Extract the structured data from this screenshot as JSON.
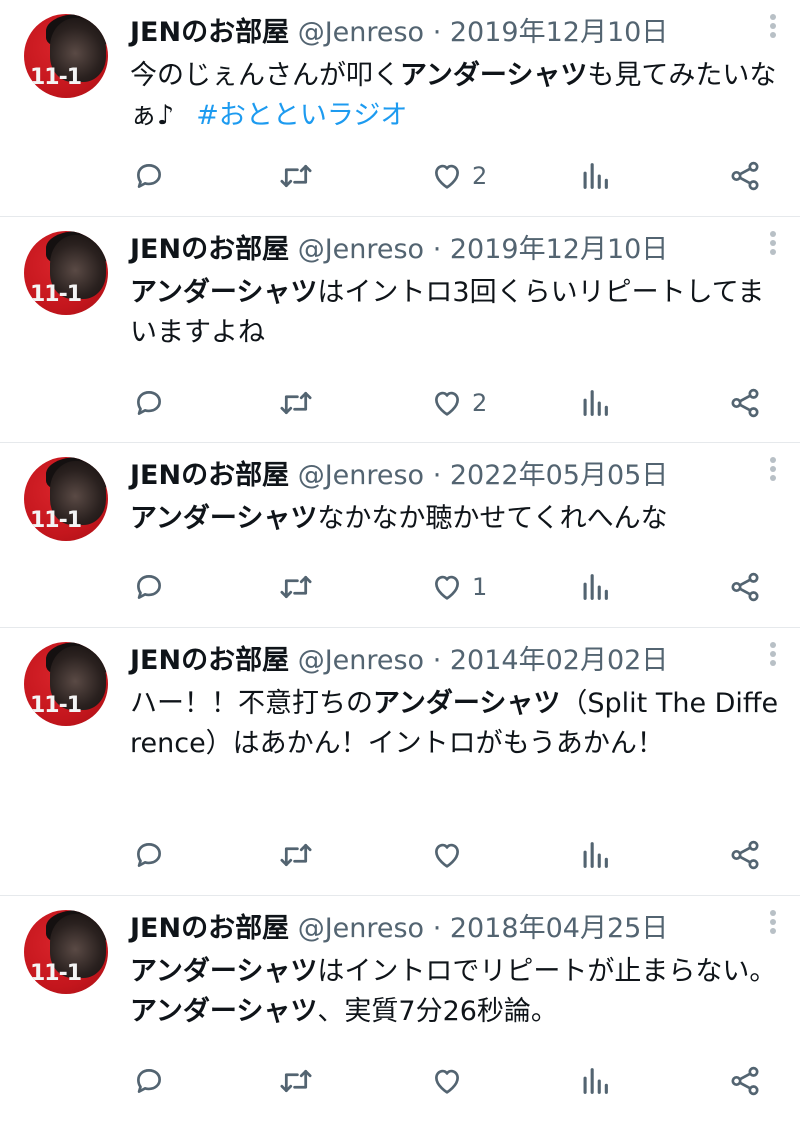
{
  "user": {
    "name": "JENのお部屋",
    "handle": "@Jenreso",
    "separator": "·",
    "avatar_text": "11-1"
  },
  "tweets": [
    {
      "date": "2019年12月10日",
      "segments": [
        {
          "text": "今のじぇんさんが叩く",
          "bold": false
        },
        {
          "text": "アンダーシャツ",
          "bold": true
        },
        {
          "text": "も見てみたいなぁ♪",
          "bold": false
        }
      ],
      "hashtag": "#おとといラジオ",
      "likes": "2"
    },
    {
      "date": "2019年12月10日",
      "segments": [
        {
          "text": "アンダーシャツ",
          "bold": true
        },
        {
          "text": "はイントロ3回くらいリピートしてまいますよね",
          "bold": false
        }
      ],
      "hashtag": "",
      "likes": "2"
    },
    {
      "date": "2022年05月05日",
      "segments": [
        {
          "text": "アンダーシャツ",
          "bold": true
        },
        {
          "text": "なかなか聴かせてくれへんな",
          "bold": false
        }
      ],
      "hashtag": "",
      "likes": "1"
    },
    {
      "date": "2014年02月02日",
      "segments": [
        {
          "text": "ハー！！不意打ちの",
          "bold": false
        },
        {
          "text": "アンダーシャツ",
          "bold": true
        },
        {
          "text": "（Split The Difference）はあかん！イントロがもうあかん！",
          "bold": false
        }
      ],
      "hashtag": "",
      "likes": ""
    },
    {
      "date": "2018年04月25日",
      "segments": [
        {
          "text": "アンダーシャツ",
          "bold": true
        },
        {
          "text": "はイントロでリピートが止まらない。",
          "bold": false
        },
        {
          "text": "アンダーシャツ",
          "bold": true
        },
        {
          "text": "、実質7分26秒論。",
          "bold": false
        }
      ],
      "hashtag": "",
      "likes": ""
    }
  ],
  "icons": {
    "reply": "reply-icon",
    "retweet": "retweet-icon",
    "like": "heart-icon",
    "views": "views-icon",
    "share": "share-icon",
    "more": "more-vertical-icon"
  },
  "colors": {
    "text": "#0f1419",
    "muted": "#536471",
    "hashtag": "#1d9bf0",
    "avatar_bg": "#c4161d",
    "divider": "#e6e9ec"
  }
}
